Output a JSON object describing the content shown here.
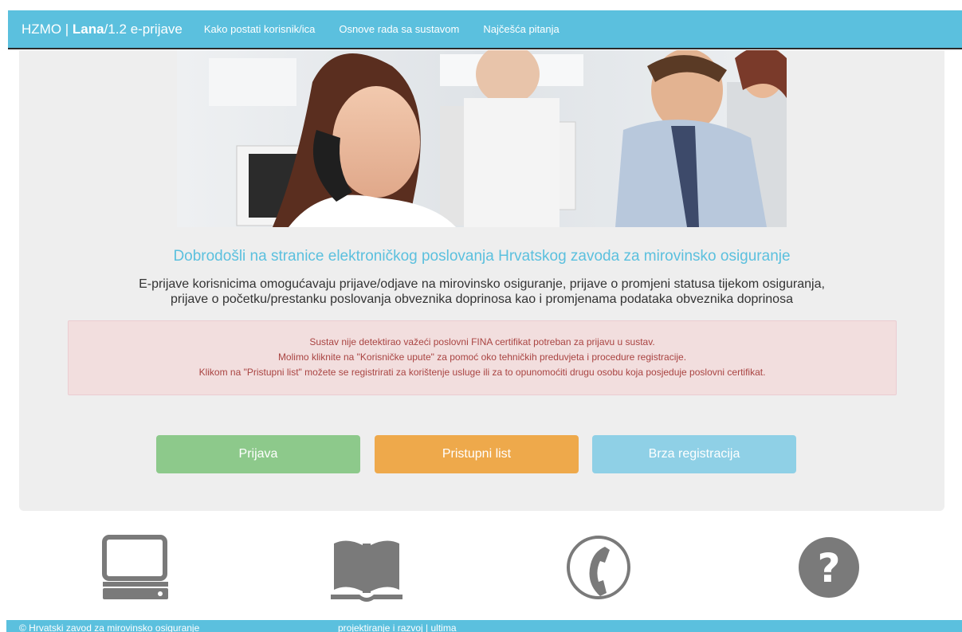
{
  "navbar": {
    "brand_prefix": "HZMO | ",
    "brand_bold": "Lana",
    "brand_suffix": "/1.2 e-prijave",
    "links": [
      {
        "label": "Kako postati korisnik/ica"
      },
      {
        "label": "Osnove rada sa sustavom"
      },
      {
        "label": "Najčešća pitanja"
      }
    ]
  },
  "main": {
    "welcome": "Dobrodošli na stranice elektroničkog poslovanja Hrvatskog zavoda za mirovinsko osiguranje",
    "intro_line1": "E-prijave korisnicima omogućavaju prijave/odjave na mirovinsko osiguranje, prijave o promjeni statusa tijekom osiguranja,",
    "intro_line2": "prijave o početku/prestanku poslovanja obveznika doprinosa kao i promjenama podataka obveznika doprinosa"
  },
  "alert": {
    "line1": "Sustav nije detektirao važeći poslovni FINA certifikat potreban za prijavu u sustav.",
    "line2": "Molimo kliknite na \"Korisničke upute\" za pomoć oko tehničkih preduvjeta i procedure registracije.",
    "line3": "Klikom na \"Pristupni list\" možete se registrirati za korištenje usluge ili za to opunomoćiti drugu osobu koja posjeduje poslovni certifikat."
  },
  "buttons": {
    "login": "Prijava",
    "access_sheet": "Pristupni list",
    "quick_registration": "Brza registracija"
  },
  "icons": [
    "computer-icon",
    "book-icon",
    "phone-icon",
    "question-icon"
  ],
  "footer": {
    "copyright": "© Hrvatski zavod za mirovinsko osiguranje",
    "credits": "projektiranje i razvoj | ultima"
  },
  "colors": {
    "navbar": "#5bc0de",
    "panel": "#eeeeee",
    "alert_bg": "#f2dede",
    "alert_text": "#a94442",
    "btn_green": "#8dc98b",
    "btn_orange": "#eea94b",
    "btn_blue": "#8fd0e6",
    "icon_gray": "#7a7a7a"
  }
}
